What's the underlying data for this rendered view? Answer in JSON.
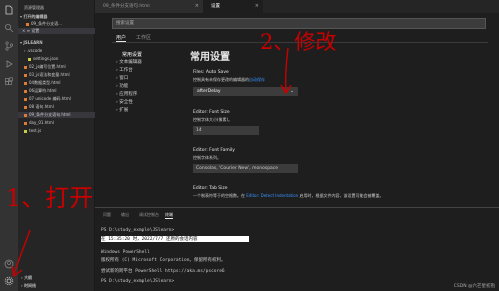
{
  "sidebar": {
    "title": "资源管理器",
    "open_editors": "打开的编辑器",
    "open_files": [
      "09_条件分支语...",
      "设置"
    ],
    "open_files_close": "×",
    "project": "JSLEARN",
    "items": [
      {
        "label": ".vscode"
      },
      {
        "label": "settings.json"
      },
      {
        "label": "02_js编写位置.html"
      },
      {
        "label": "03_js语法和变量.html"
      },
      {
        "label": "04数据类型.html"
      },
      {
        "label": "06运算符.html"
      },
      {
        "label": "07 unicode 编码.html"
      },
      {
        "label": "08 语句.html"
      },
      {
        "label": "09_条件分支语句.html"
      },
      {
        "label": "day_01.html"
      },
      {
        "label": "test.js"
      }
    ],
    "outline": "大纲",
    "timeline": "时间线"
  },
  "tabs": [
    {
      "label": "09_条件分支语句.html",
      "close": "×"
    },
    {
      "label": "设置",
      "close": "×"
    }
  ],
  "settings": {
    "search_placeholder": "搜索设置",
    "scope_tabs": [
      "用户",
      "工作区"
    ],
    "tree": [
      "常用设置",
      "文本编辑器",
      "工作台",
      "窗口",
      "功能",
      "应用程序",
      "安全性",
      "扩展"
    ],
    "heading": "常用设置",
    "auto_save_title": "Files: Auto Save",
    "auto_save_desc_prefix": "控制具有未保存更改的编辑器的",
    "auto_save_desc_link": "自动保存",
    "auto_save_value": "afterDelay",
    "font_size_title": "Editor: Font Size",
    "font_size_desc": "控制字体大小(像素)。",
    "font_size_value": "14",
    "font_family_title": "Editor: Font Family",
    "font_family_desc": "控制字体系列。",
    "font_family_value": "Consolas, 'Courier New', monospace",
    "tab_size_title": "Editor: Tab Size",
    "tab_size_desc_prefix": "一个制表符等于的空格数。在",
    "tab_size_desc_link": "Editor: Detect Indentation",
    "tab_size_desc_suffix": "启用时，根据文件内容，该设置可能会被覆盖。"
  },
  "panel": {
    "tabs": [
      "问题",
      "输出",
      "调试控制台",
      "终端"
    ],
    "terminal": [
      "PS D:\\study_exmple\\JSlearn>",
      " 在 15:35:20 时，2022/7/7 还原的会话内容",
      "Windows PowerShell",
      "版权所有 (C) Microsoft Corporation。保留所有权利。",
      "尝试新的跨平台 PowerShell https://aka.ms/pscore6",
      "PS D:\\study_exmple\\JSlearn>"
    ]
  },
  "annotations": {
    "top": "2、修改",
    "bottom": "1、打开"
  },
  "watermark": "CSDN @六芒星初抱",
  "colors": {
    "annotation": "#c80000",
    "link": "#3794ff",
    "accent": "#007acc"
  }
}
